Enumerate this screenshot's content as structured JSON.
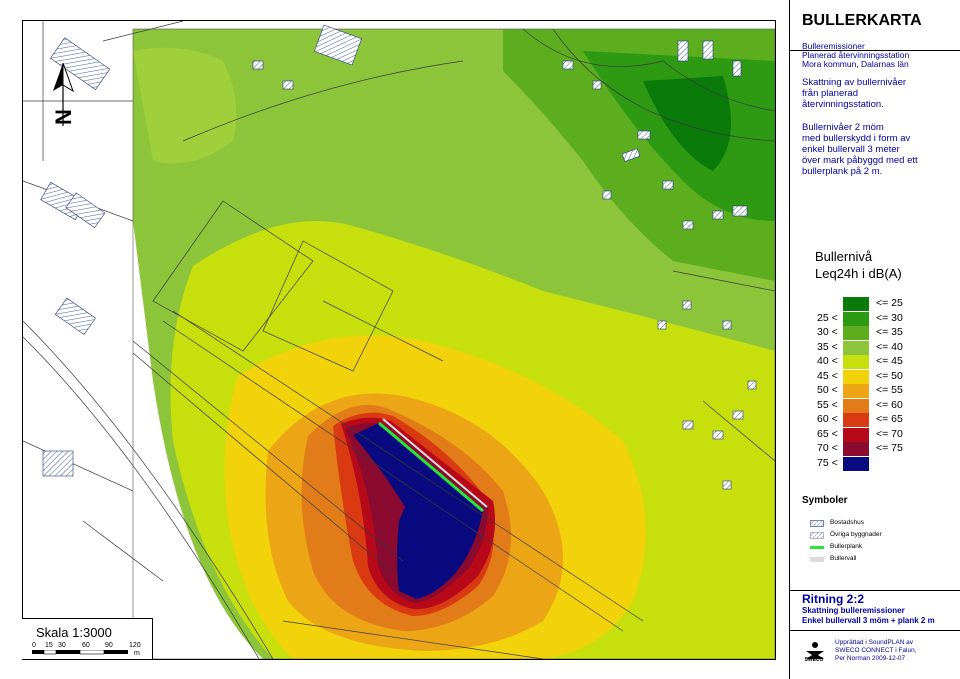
{
  "title": "BULLERKARTA",
  "subtitle_lines": [
    "Bulleremissioner",
    "Planerad återvinningsstation",
    "Mora kommun, Dalarnas län"
  ],
  "desc1_lines": [
    "Skattning av bullernivåer",
    "från planerad",
    "återvinningsstation."
  ],
  "desc2_lines": [
    "Bullernivåer 2 möm",
    "med bullerskydd i form av",
    "enkel bullervall 3 meter",
    "över mark påbyggd med ett",
    "bullerplank på 2 m."
  ],
  "legend": {
    "heading_line1": "Bullernivå",
    "heading_line2": "Leq24h i dB(A)",
    "rows": [
      {
        "lo": "",
        "hi": "<= 25",
        "color": "#0a7a0a"
      },
      {
        "lo": "25 <",
        "hi": "<= 30",
        "color": "#2e9a14"
      },
      {
        "lo": "30 <",
        "hi": "<= 35",
        "color": "#5cae1e"
      },
      {
        "lo": "35 <",
        "hi": "<= 40",
        "color": "#8cc43a"
      },
      {
        "lo": "40 <",
        "hi": "<= 45",
        "color": "#c8df0e"
      },
      {
        "lo": "45 <",
        "hi": "<= 50",
        "color": "#f2d20a"
      },
      {
        "lo": "50 <",
        "hi": "<= 55",
        "color": "#eba515"
      },
      {
        "lo": "55 <",
        "hi": "<= 60",
        "color": "#e27c18"
      },
      {
        "lo": "60 <",
        "hi": "<= 65",
        "color": "#d93a12"
      },
      {
        "lo": "65 <",
        "hi": "<= 70",
        "color": "#b8091a"
      },
      {
        "lo": "70 <",
        "hi": "<= 75",
        "color": "#8a0a30"
      },
      {
        "lo": "75 <",
        "hi": "",
        "color": "#0a0a80"
      }
    ]
  },
  "symbols": {
    "heading": "Symboler",
    "items": [
      {
        "label": "Bostadshus",
        "icon": "hatched-rect-icon"
      },
      {
        "label": "Övriga byggnader",
        "icon": "hatched-rect-light-icon"
      },
      {
        "label": "Bullerplank",
        "icon": "green-line-icon"
      },
      {
        "label": "Bullervall",
        "icon": "gray-fill-icon"
      }
    ]
  },
  "drawing": {
    "title": "Ritning 2:2",
    "sub_line1": "Skattning bulleremissioner",
    "sub_line2": "Enkel bullervall 3 möm + plank 2 m"
  },
  "credit_lines": [
    "Upprättad i SoundPLAN av",
    "SWECO CONNECT i Falun,",
    "Per Norman 2009-12-07"
  ],
  "logo_text": "SWECO",
  "scale": {
    "label": "Skala 1:3000",
    "ticks": [
      "0",
      "15",
      "30",
      "60",
      "90",
      "120"
    ],
    "unit": "m"
  },
  "north_label": "N"
}
